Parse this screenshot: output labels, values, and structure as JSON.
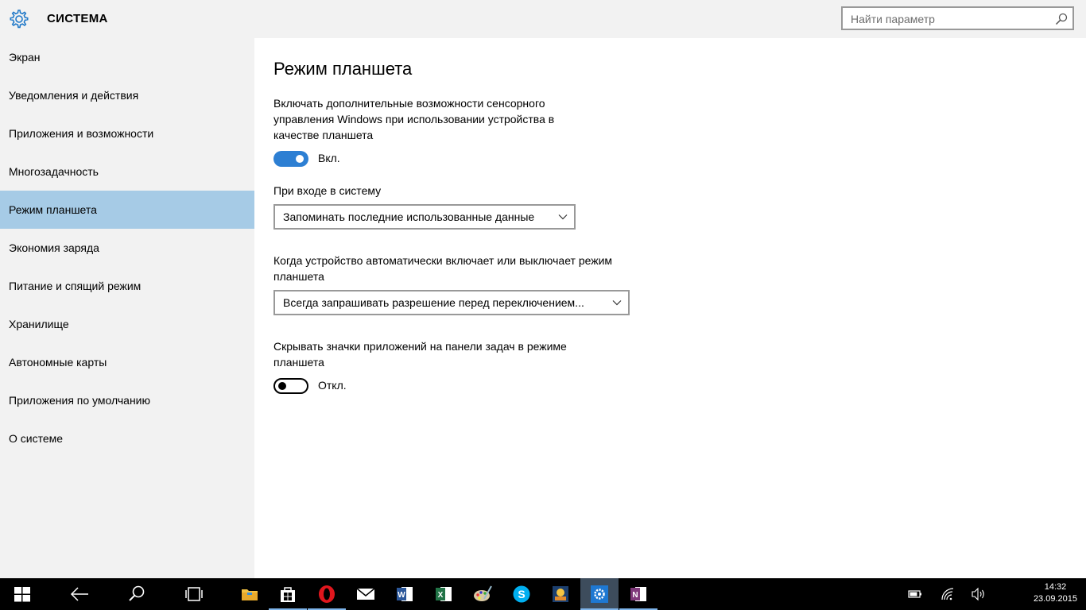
{
  "header": {
    "title": "СИСТЕМА",
    "search_placeholder": "Найти параметр"
  },
  "sidebar": {
    "items": [
      {
        "label": "Экран"
      },
      {
        "label": "Уведомления и действия"
      },
      {
        "label": "Приложения и возможности"
      },
      {
        "label": "Многозадачность"
      },
      {
        "label": "Режим планшета",
        "active": true
      },
      {
        "label": "Экономия заряда"
      },
      {
        "label": "Питание и спящий режим"
      },
      {
        "label": "Хранилище"
      },
      {
        "label": "Автономные карты"
      },
      {
        "label": "Приложения по умолчанию"
      },
      {
        "label": "О системе"
      }
    ]
  },
  "main": {
    "title": "Режим планшета",
    "setting1": {
      "description": "Включать дополнительные возможности сенсорного управления Windows при использовании устройства в качестве планшета",
      "toggle_state": "Вкл.",
      "enabled": true
    },
    "setting2": {
      "label": "При входе в систему",
      "selected": "Запоминать последние использованные данные"
    },
    "setting3": {
      "label": "Когда устройство автоматически включает или выключает режим планшета",
      "selected": "Всегда запрашивать разрешение перед переключением..."
    },
    "setting4": {
      "description": "Скрывать значки приложений на панели задач в режиме планшета",
      "toggle_state": "Откл.",
      "enabled": false
    }
  },
  "taskbar": {
    "icons": [
      "windows-start-icon",
      "back-icon",
      "search-icon",
      "task-view-icon",
      "file-explorer-icon",
      "store-icon",
      "opera-icon",
      "mail-icon",
      "word-icon",
      "excel-icon",
      "paint-icon",
      "skype-icon",
      "photo-app-icon",
      "settings-icon",
      "onenote-icon"
    ],
    "tray_icons": [
      "battery-icon",
      "wifi-icon",
      "volume-icon"
    ],
    "time": "14:32",
    "date": "23.09.2015"
  },
  "colors": {
    "accent": "#2d7fd3",
    "sidebar_active": "#a6cbe6",
    "panel_bg": "#f2f2f2",
    "taskbar_bg": "#000000"
  }
}
